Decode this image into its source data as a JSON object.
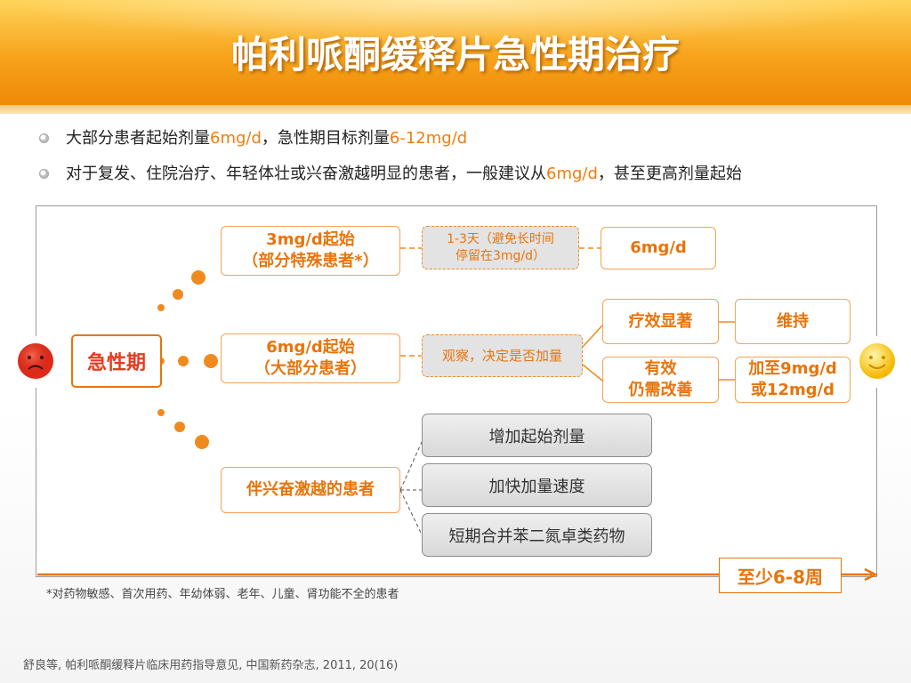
{
  "title": "帕利哌酮缓释片急性期治疗",
  "bullets": [
    {
      "parts": [
        {
          "text": "大部分患者起始剂量",
          "highlight": false
        },
        {
          "text": "6mg/d",
          "highlight": true
        },
        {
          "text": "，急性期目标剂量",
          "highlight": false
        },
        {
          "text": "6-12mg/d",
          "highlight": true
        }
      ]
    },
    {
      "parts": [
        {
          "text": "对于复发、住院治疗、年轻体壮或兴奋激越明显的患者，一般建议从",
          "highlight": false
        },
        {
          "text": "6mg/d",
          "highlight": true
        },
        {
          "text": "，甚至更高剂量起始",
          "highlight": false
        }
      ]
    }
  ],
  "diagram": {
    "acute_label": "急性期",
    "branch_top": {
      "line1": "3mg/d起始",
      "line2": "（部分特殊患者*）"
    },
    "branch_top_transition": {
      "line1": "1-3天（避免长时间",
      "line2": "停留在3mg/d）"
    },
    "branch_top_result": "6mg/d",
    "branch_mid": {
      "line1": "6mg/d起始",
      "line2": "（大部分患者）"
    },
    "branch_mid_transition": "观察，决定是否加量",
    "branch_mid_effective": "疗效显著",
    "branch_mid_maintain": "维持",
    "branch_mid_improve": {
      "line1": "有效",
      "line2": "仍需改善"
    },
    "branch_mid_increase": {
      "line1": "加至9mg/d",
      "line2": "或12mg/d"
    },
    "branch_bottom": "伴兴奋激越的患者",
    "branch_bottom_options": [
      "增加起始剂量",
      "加快加量速度",
      "短期合并苯二氮卓类药物"
    ],
    "duration": "至少6-8周"
  },
  "footnote": "*对药物敏感、首次用药、年幼体弱、老年、儿童、肾功能不全的患者",
  "citation": "舒良等, 帕利哌酮缓释片临床用药指导意见, 中国新药杂志, 2011, 20(16)",
  "colors": {
    "accent": "#e8740b",
    "header": "#f7a21a",
    "sad_face": "#e02a1a",
    "happy_face": "#ffd23a"
  }
}
